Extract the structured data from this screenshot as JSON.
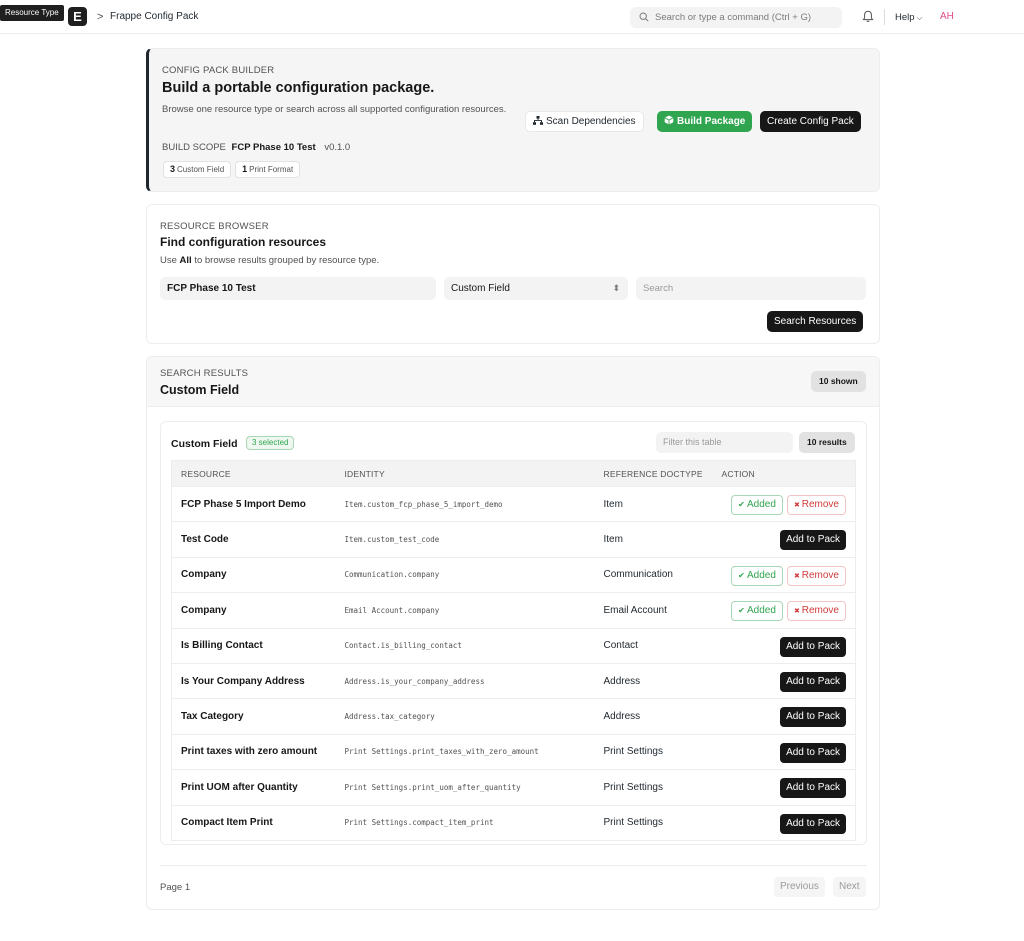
{
  "navbar": {
    "tooltip": "Resource Type",
    "logo": "E",
    "breadcrumb_sep": ">",
    "breadcrumb": "Frappe Config Pack",
    "search_placeholder": "Search or type a command (Ctrl + G)",
    "help_label": "Help",
    "avatar_initials": "AH"
  },
  "hero": {
    "eyebrow": "CONFIG PACK BUILDER",
    "title": "Build a portable configuration package.",
    "description": "Browse one resource type or search across all supported configuration resources.",
    "scope_label": "BUILD SCOPE",
    "scope_name": "FCP Phase 10 Test",
    "scope_version": "v0.1.0",
    "chips": [
      {
        "count": "3",
        "label": "Custom Field"
      },
      {
        "count": "1",
        "label": "Print Format"
      }
    ],
    "scan_label": "Scan Dependencies",
    "build_label": "Build Package",
    "create_label": "Create Config Pack"
  },
  "browser": {
    "eyebrow": "RESOURCE BROWSER",
    "title": "Find configuration resources",
    "hint_prefix": "Use",
    "hint_bold": "All",
    "hint_suffix": "to browse results grouped by resource type.",
    "pack_value": "FCP Phase 10 Test",
    "type_value": "Custom Field",
    "search_placeholder": "Search",
    "search_button": "Search Resources"
  },
  "results": {
    "eyebrow": "SEARCH RESULTS",
    "title": "Custom Field",
    "shown_badge": "10 shown",
    "table_title": "Custom Field",
    "selected_badge": "3 selected",
    "filter_placeholder": "Filter this table",
    "results_badge": "10 results",
    "columns": [
      "RESOURCE",
      "IDENTITY",
      "REFERENCE DOCTYPE",
      "ACTION"
    ],
    "added_label": "Added",
    "remove_label": "Remove",
    "add_label": "Add to Pack",
    "rows": [
      {
        "resource": "FCP Phase 5 Import Demo",
        "identity": "Item.custom_fcp_phase_5_import_demo",
        "ref": "Item",
        "added": true
      },
      {
        "resource": "Test Code",
        "identity": "Item.custom_test_code",
        "ref": "Item",
        "added": false
      },
      {
        "resource": "Company",
        "identity": "Communication.company",
        "ref": "Communication",
        "added": true
      },
      {
        "resource": "Company",
        "identity": "Email Account.company",
        "ref": "Email Account",
        "added": true
      },
      {
        "resource": "Is Billing Contact",
        "identity": "Contact.is_billing_contact",
        "ref": "Contact",
        "added": false
      },
      {
        "resource": "Is Your Company Address",
        "identity": "Address.is_your_company_address",
        "ref": "Address",
        "added": false
      },
      {
        "resource": "Tax Category",
        "identity": "Address.tax_category",
        "ref": "Address",
        "added": false
      },
      {
        "resource": "Print taxes with zero amount",
        "identity": "Print Settings.print_taxes_with_zero_amount",
        "ref": "Print Settings",
        "added": false
      },
      {
        "resource": "Print UOM after Quantity",
        "identity": "Print Settings.print_uom_after_quantity",
        "ref": "Print Settings",
        "added": false
      },
      {
        "resource": "Compact Item Print",
        "identity": "Print Settings.compact_item_print",
        "ref": "Print Settings",
        "added": false
      }
    ],
    "page_label": "Page 1",
    "prev_label": "Previous",
    "next_label": "Next"
  },
  "colors": {
    "accent_green": "#30a54f",
    "danger_red": "#d03b3b",
    "dark": "#171717"
  }
}
